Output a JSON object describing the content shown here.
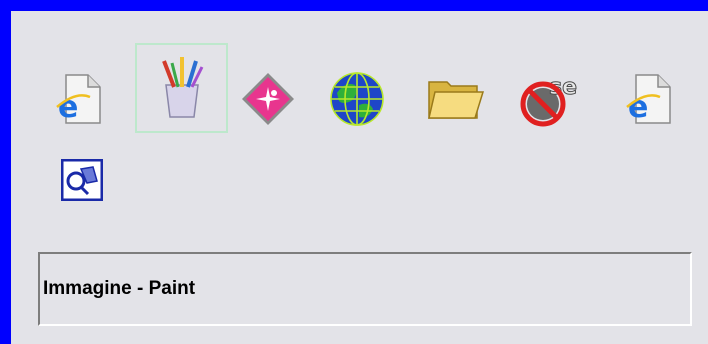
{
  "launcher": {
    "icons": [
      {
        "name": "internet-explorer-page-icon",
        "selected": false
      },
      {
        "name": "paint-brushes-icon",
        "selected": true
      },
      {
        "name": "pink-diamond-app-icon",
        "selected": false
      },
      {
        "name": "globe-icon",
        "selected": false
      },
      {
        "name": "folder-icon",
        "selected": false
      },
      {
        "name": "no-se-icon",
        "selected": false
      },
      {
        "name": "internet-explorer-page-icon",
        "selected": false
      },
      {
        "name": "search-tool-icon",
        "selected": false
      }
    ]
  },
  "status": {
    "text": "Immagine - Paint"
  },
  "colors": {
    "frame": "#0000ff",
    "panel": "#e3e3e8",
    "selection": "#bde8cc"
  }
}
